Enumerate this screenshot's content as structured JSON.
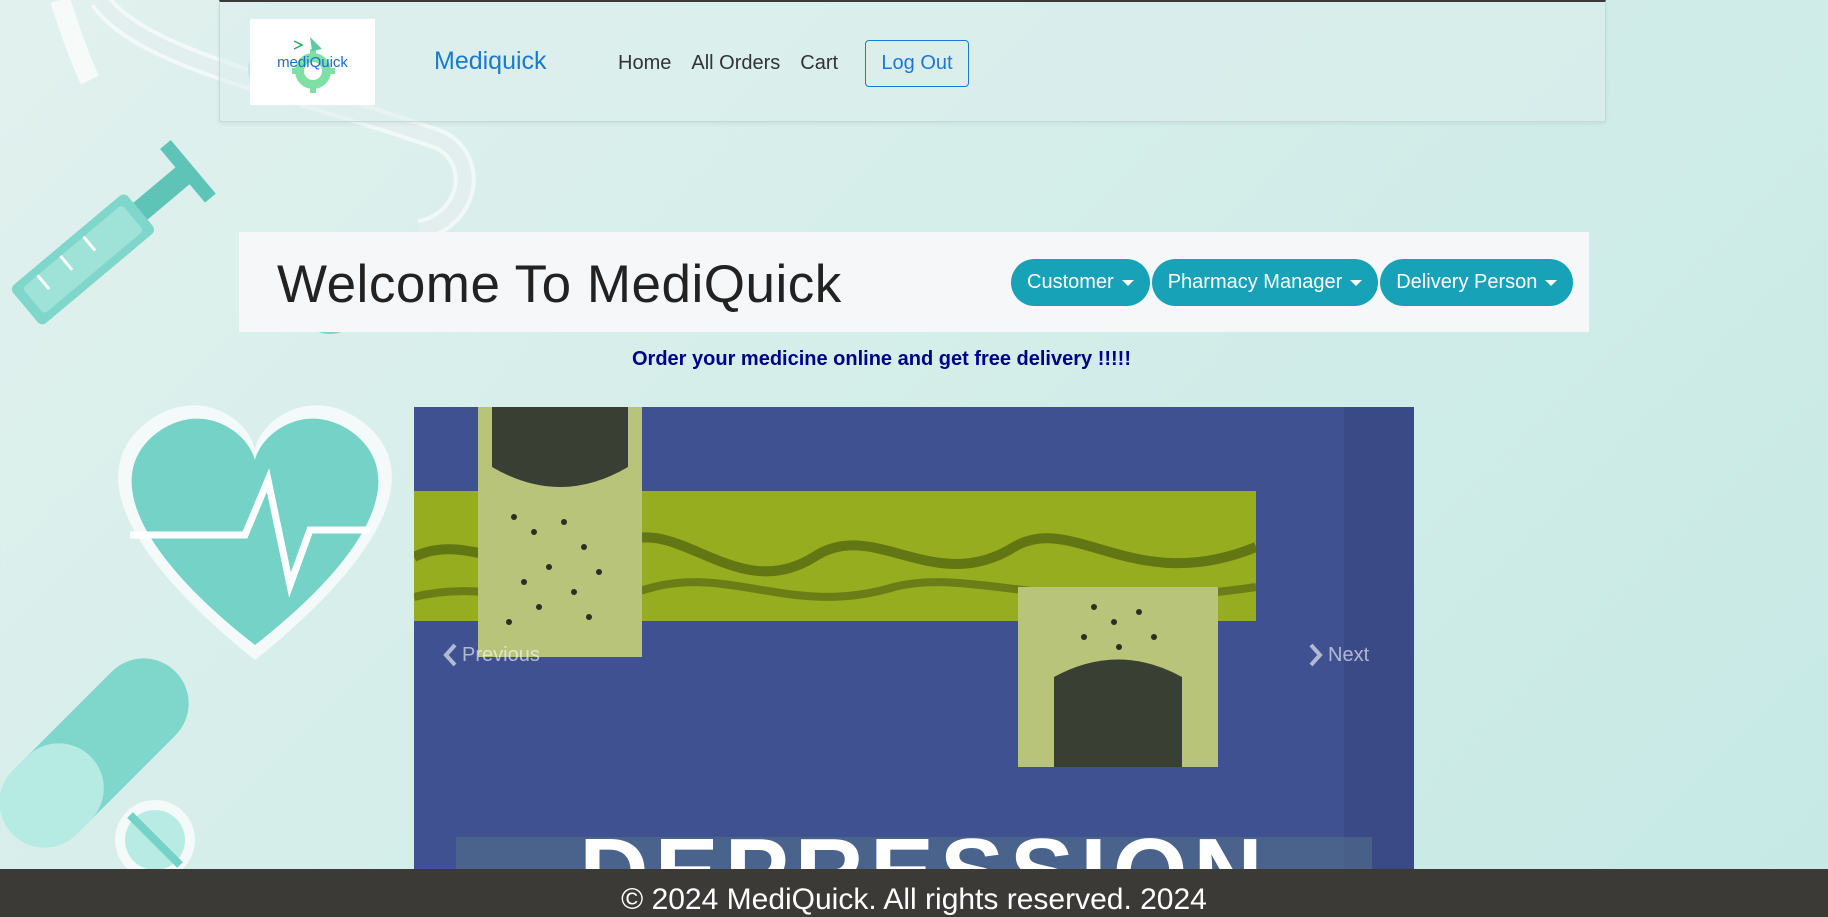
{
  "navbar": {
    "logo_text": "mediQuick",
    "brand": "Mediquick",
    "links": [
      "Home",
      "All Orders",
      "Cart"
    ],
    "logout_label": "Log Out"
  },
  "welcome": {
    "title": "Welcome To MediQuick",
    "roles": [
      "Customer",
      "Pharmacy Manager",
      "Delivery Person"
    ]
  },
  "tagline": "Order your medicine online and get free delivery !!!!!",
  "carousel": {
    "prev_label": "Previous",
    "next_label": "Next",
    "slide_text": "DEPRESSION"
  },
  "footer": {
    "text": "© 2024 MediQuick. All rights reserved. 2024"
  },
  "colors": {
    "primary": "#1a7ad1",
    "info": "#17a2b8",
    "tagline": "#00008b",
    "footer_bg": "#3b3a37",
    "carousel_bg": "#3f5191"
  },
  "icons": [
    "chevron-left-icon",
    "chevron-right-icon",
    "caret-down-icon"
  ]
}
